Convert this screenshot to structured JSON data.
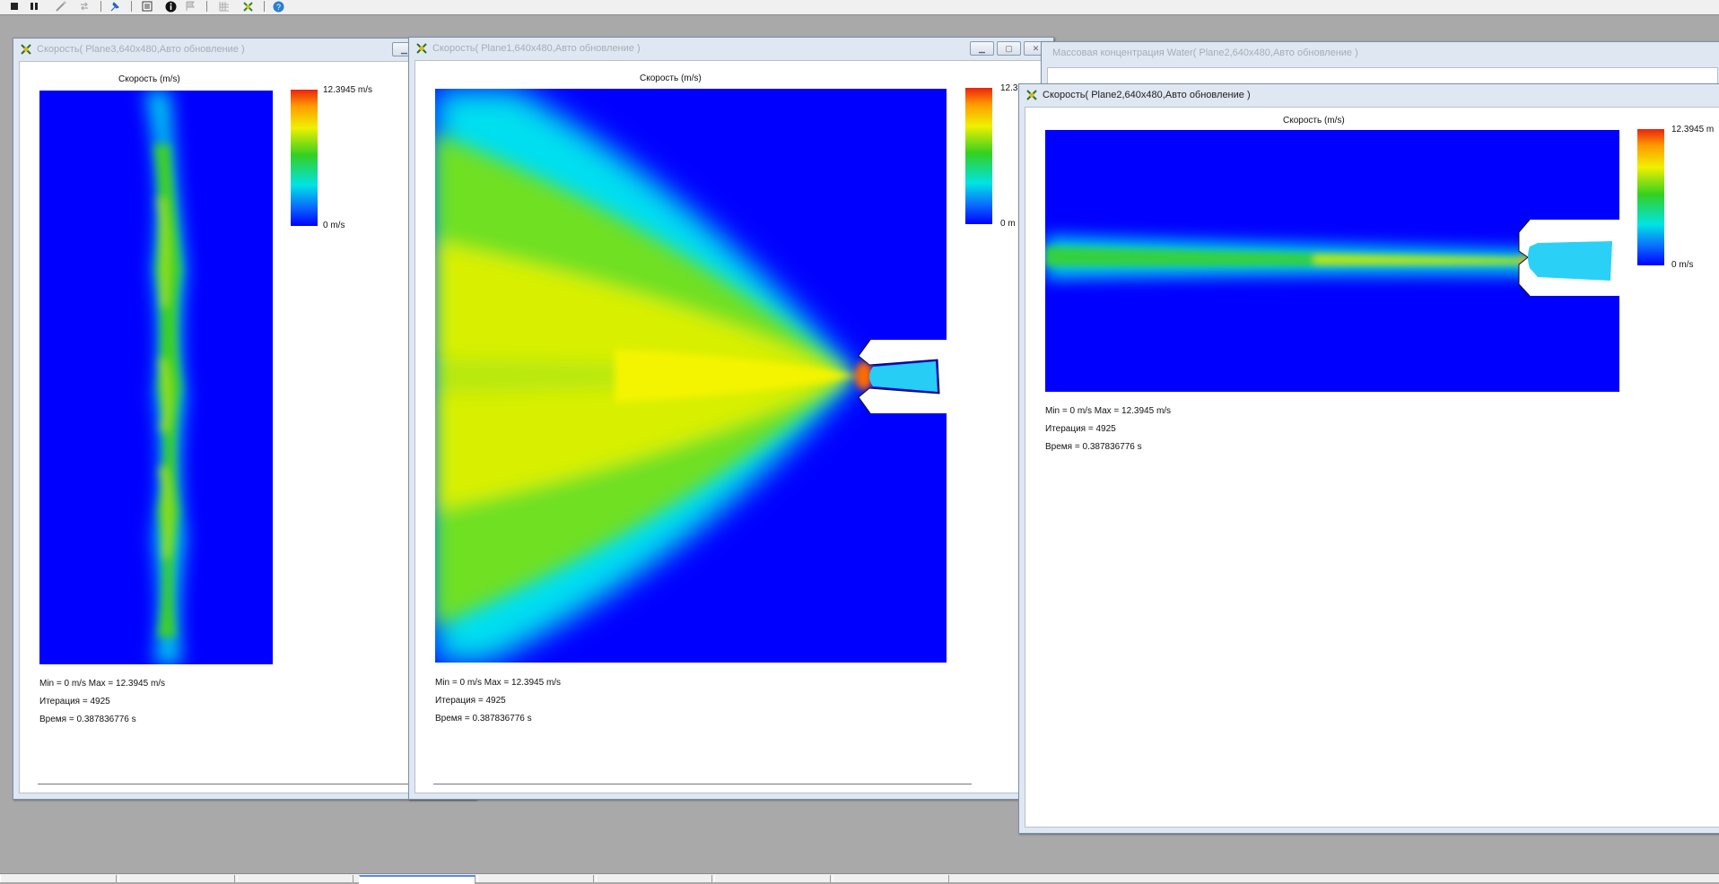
{
  "colors": {
    "desktop": "#a9a9a9",
    "field_blue": "#0000ff",
    "title_inactive": "#a5acb5",
    "title_active": "#1c1c1c"
  },
  "toolbar": {
    "icons": [
      "stop-icon",
      "pause-icon",
      "wand-icon",
      "arrows-icon",
      "pin-icon",
      "sheet-icon",
      "info-icon",
      "flag-icon",
      "grid-icon",
      "tool-icon",
      "help-icon"
    ]
  },
  "windows": [
    {
      "title": "Скорость( Plane3,640x480,Авто обновление )",
      "plot_title": "Скорость (m/s)",
      "cbar_max": "12.3945 m/s",
      "cbar_min": "0 m/s",
      "minmax": "Min = 0 m/s   Max = 12.3945 m/s",
      "iteration": "Итерация = 4925",
      "time": "Время = 0.387836776 s"
    },
    {
      "title": "Скорость( Plane1,640x480,Авто обновление )",
      "plot_title": "Скорость (m/s)",
      "cbar_max": "12.3",
      "cbar_min": "0 m",
      "minmax": "Min = 0 m/s   Max = 12.3945 m/s",
      "iteration": "Итерация = 4925",
      "time": "Время = 0.387836776 s"
    },
    {
      "title": "Массовая концентрация Water( Plane2,640x480,Авто обновление )"
    },
    {
      "title": "Скорость( Plane2,640x480,Авто обновление )",
      "plot_title": "Скорость (m/s)",
      "cbar_max": "12.3945 m",
      "cbar_min": "0 m/s",
      "minmax": "Min = 0 m/s   Max = 12.3945 m/s",
      "iteration": "Итерация = 4925",
      "time": "Время = 0.387836776 s"
    }
  ]
}
